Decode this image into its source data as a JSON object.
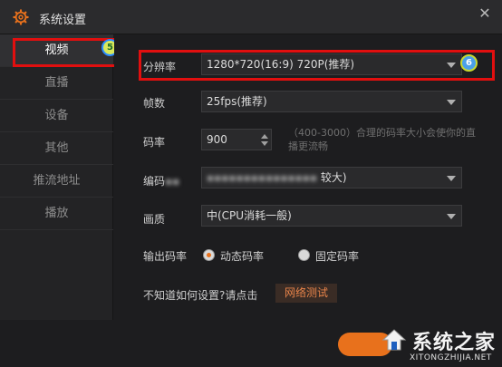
{
  "window": {
    "title": "系统设置",
    "close_glyph": "✕"
  },
  "sidebar": {
    "items": [
      {
        "label": "视频"
      },
      {
        "label": "直播"
      },
      {
        "label": "设备"
      },
      {
        "label": "其他"
      },
      {
        "label": "推流地址"
      },
      {
        "label": "播放"
      }
    ],
    "active_index": 0,
    "badge": "5"
  },
  "resolution": {
    "label": "分辨率",
    "value": "1280*720(16:9) 720P(推荐)",
    "badge": "6"
  },
  "framerate": {
    "label": "帧数",
    "value": "25fps(推荐)"
  },
  "bitrate": {
    "label": "码率",
    "value": "900",
    "hint": "（400-3000）合理的码率大小会使你的直播更流畅"
  },
  "encoder": {
    "label": "编码",
    "value": "较大)"
  },
  "quality": {
    "label": "画质",
    "value": "中(CPU消耗一般)"
  },
  "rate_mode": {
    "label": "输出码率",
    "options": [
      {
        "label": "动态码率",
        "checked": true
      },
      {
        "label": "固定码率",
        "checked": false
      }
    ]
  },
  "help": {
    "prompt": "不知道如何设置?请点击",
    "button": "网络测试"
  },
  "watermark": {
    "text": "系统之家",
    "sub": "XITONGZHIJIA.NET"
  },
  "colors": {
    "accent": "#e8711c",
    "highlight": "#e10f0f"
  }
}
